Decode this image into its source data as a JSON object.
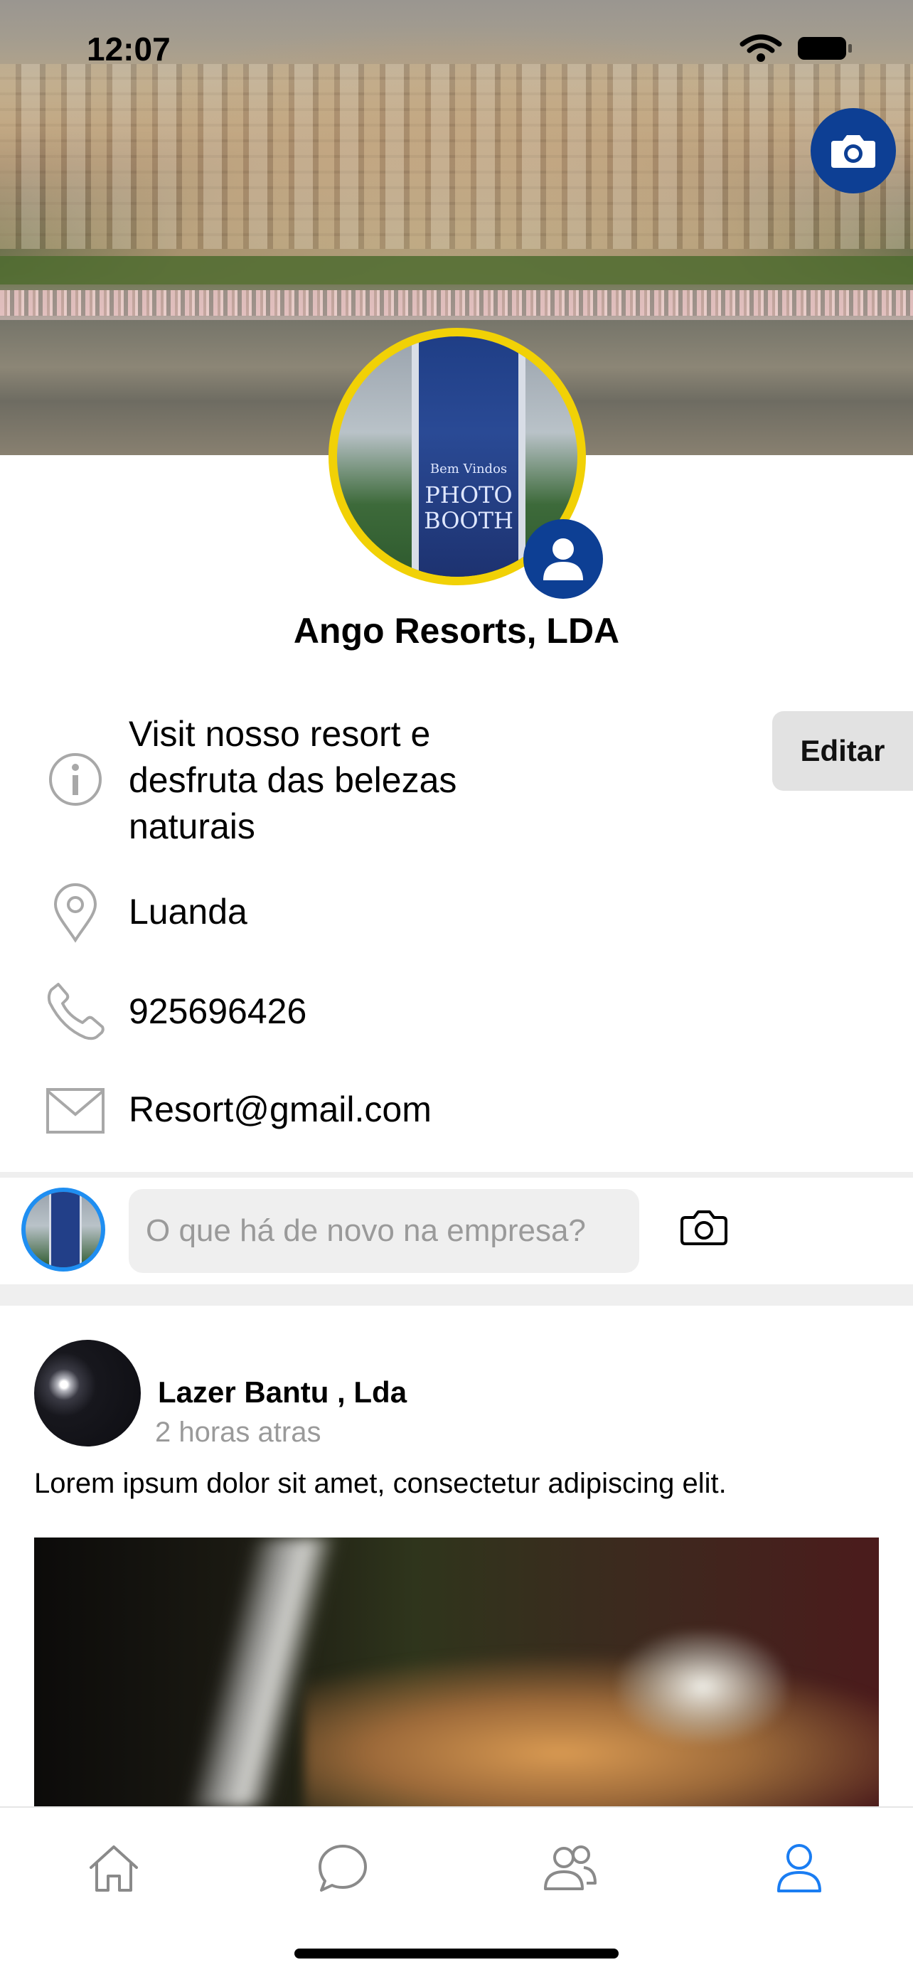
{
  "status_bar": {
    "time": "12:07"
  },
  "profile": {
    "name": "Ango Resorts, LDA",
    "description": "Visit nosso resort e desfruta das belezas naturais",
    "description_lines": [
      "Visit nosso resort e",
      "desfruta das belezas",
      "naturais"
    ],
    "location": "Luanda",
    "phone": "925696426",
    "email": "Resort@gmail.com",
    "edit_label": "Editar",
    "avatar_booth_text": [
      "Bem Vindos",
      "PHOTO",
      "BOOTH"
    ]
  },
  "composer": {
    "placeholder": "O que há de novo na empresa?"
  },
  "post": {
    "author": "Lazer Bantu , Lda",
    "time": "2 horas atras",
    "text": "Lorem ipsum dolor sit amet, consectetur adipiscing elit."
  },
  "tabbar": {
    "items": [
      {
        "icon": "home-icon"
      },
      {
        "icon": "chat-icon"
      },
      {
        "icon": "people-icon"
      },
      {
        "icon": "profile-icon",
        "active": true
      }
    ],
    "active_color": "#1a7df2",
    "inactive_color": "#8a8a8a"
  },
  "colors": {
    "accent": "#0d3f94",
    "avatar_ring": "#f1d106"
  }
}
